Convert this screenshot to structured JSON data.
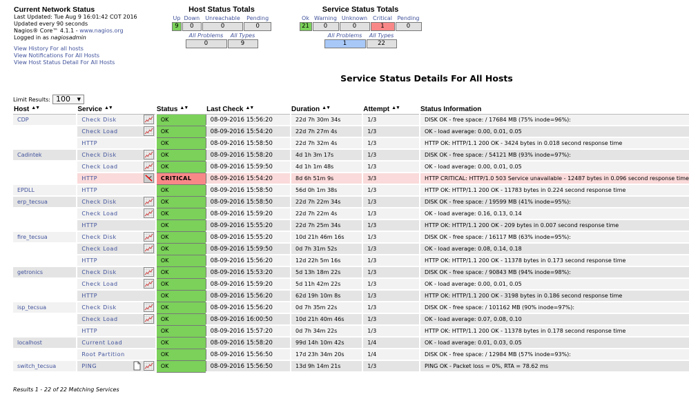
{
  "info": {
    "title": "Current Network Status",
    "last_updated": "Last Updated: Tue Aug 9 16:01:42 COT 2016",
    "update_interval": "Updated every 90 seconds",
    "version_prefix": "Nagios® Core™ 4.1.1 - ",
    "version_link": "www.nagios.org",
    "logged_in_prefix": "Logged in as ",
    "logged_in_user": "nagiosadmin",
    "links": [
      "View History For all hosts",
      "View Notifications For All Hosts",
      "View Host Status Detail For All Hosts"
    ]
  },
  "host_totals": {
    "title": "Host Status Totals",
    "labels": [
      "Up",
      "Down",
      "Unreachable",
      "Pending"
    ],
    "values": [
      "9",
      "0",
      "0",
      "0"
    ],
    "sub_labels": [
      "All Problems",
      "All Types"
    ],
    "sub_values": [
      "0",
      "9"
    ]
  },
  "service_totals": {
    "title": "Service Status Totals",
    "labels": [
      "Ok",
      "Warning",
      "Unknown",
      "Critical",
      "Pending"
    ],
    "values": [
      "21",
      "0",
      "0",
      "1",
      "0"
    ],
    "sub_labels": [
      "All Problems",
      "All Types"
    ],
    "sub_values": [
      "1",
      "22"
    ]
  },
  "page_title": "Service Status Details For All Hosts",
  "limit": {
    "label": "Limit Results:",
    "value": "100"
  },
  "columns": [
    "Host",
    "Service",
    "Status",
    "Last Check",
    "Duration",
    "Attempt",
    "Status Information"
  ],
  "colors": {
    "ok": "#7bd15a",
    "critical": "#f88888",
    "problems": "#a8c8f8",
    "link": "#40529b"
  },
  "rows": [
    {
      "host": "CDP",
      "service": "Check Disk",
      "graph": true,
      "status": "OK",
      "last_check": "08-09-2016 15:56:20",
      "duration": "22d 7h 30m 34s",
      "attempt": "1/3",
      "info": "DISK OK - free space: / 17684 MB (75% inode=96%):"
    },
    {
      "host": "",
      "service": "Check Load",
      "graph": true,
      "status": "OK",
      "last_check": "08-09-2016 15:54:20",
      "duration": "22d 7h 27m 4s",
      "attempt": "1/3",
      "info": "OK - load average: 0.00, 0.01, 0.05"
    },
    {
      "host": "",
      "service": "HTTP",
      "graph": false,
      "status": "OK",
      "last_check": "08-09-2016 15:58:50",
      "duration": "22d 7h 32m 4s",
      "attempt": "1/3",
      "info": "HTTP OK: HTTP/1.1 200 OK - 3424 bytes in 0.018 second response time"
    },
    {
      "host": "Cadintek",
      "service": "Check Disk",
      "graph": true,
      "status": "OK",
      "last_check": "08-09-2016 15:58:20",
      "duration": "4d 1h 3m 17s",
      "attempt": "1/3",
      "info": "DISK OK - free space: / 54121 MB (93% inode=97%):"
    },
    {
      "host": "",
      "service": "Check Load",
      "graph": true,
      "status": "OK",
      "last_check": "08-09-2016 15:59:50",
      "duration": "4d 1h 1m 48s",
      "attempt": "1/3",
      "info": "OK - load average: 0.00, 0.01, 0.05"
    },
    {
      "host": "",
      "service": "HTTP",
      "graph": "disabled",
      "status": "CRITICAL",
      "last_check": "08-09-2016 15:54:20",
      "duration": "8d 6h 51m 9s",
      "attempt": "3/3",
      "info": "HTTP CRITICAL: HTTP/1.0 503 Service unavailable - 12487 bytes in 0.096 second response time"
    },
    {
      "host": "EPDLL",
      "service": "HTTP",
      "graph": false,
      "status": "OK",
      "last_check": "08-09-2016 15:58:50",
      "duration": "56d 0h 1m 38s",
      "attempt": "1/3",
      "info": "HTTP OK: HTTP/1.1 200 OK - 11783 bytes in 0.224 second response time"
    },
    {
      "host": "erp_tecsua",
      "service": "Check Disk",
      "graph": true,
      "status": "OK",
      "last_check": "08-09-2016 15:58:50",
      "duration": "22d 7h 22m 34s",
      "attempt": "1/3",
      "info": "DISK OK - free space: / 19599 MB (41% inode=95%):"
    },
    {
      "host": "",
      "service": "Check Load",
      "graph": true,
      "status": "OK",
      "last_check": "08-09-2016 15:59:20",
      "duration": "22d 7h 22m 4s",
      "attempt": "1/3",
      "info": "OK - load average: 0.16, 0.13, 0.14"
    },
    {
      "host": "",
      "service": "HTTP",
      "graph": false,
      "status": "OK",
      "last_check": "08-09-2016 15:55:20",
      "duration": "22d 7h 25m 34s",
      "attempt": "1/3",
      "info": "HTTP OK: HTTP/1.1 200 OK - 209 bytes in 0.007 second response time"
    },
    {
      "host": "fire_tecsua",
      "service": "Check Disk",
      "graph": true,
      "status": "OK",
      "last_check": "08-09-2016 15:55:20",
      "duration": "10d 21h 46m 16s",
      "attempt": "1/3",
      "info": "DISK OK - free space: / 16117 MB (63% inode=95%):"
    },
    {
      "host": "",
      "service": "Check Load",
      "graph": true,
      "status": "OK",
      "last_check": "08-09-2016 15:59:50",
      "duration": "0d 7h 31m 52s",
      "attempt": "1/3",
      "info": "OK - load average: 0.08, 0.14, 0.18"
    },
    {
      "host": "",
      "service": "HTTP",
      "graph": false,
      "status": "OK",
      "last_check": "08-09-2016 15:56:20",
      "duration": "12d 22h 5m 16s",
      "attempt": "1/3",
      "info": "HTTP OK: HTTP/1.1 200 OK - 11378 bytes in 0.173 second response time"
    },
    {
      "host": "getronics",
      "service": "Check Disk",
      "graph": true,
      "status": "OK",
      "last_check": "08-09-2016 15:53:20",
      "duration": "5d 13h 18m 22s",
      "attempt": "1/3",
      "info": "DISK OK - free space: / 90843 MB (94% inode=98%):"
    },
    {
      "host": "",
      "service": "Check Load",
      "graph": true,
      "status": "OK",
      "last_check": "08-09-2016 15:59:20",
      "duration": "5d 11h 42m 22s",
      "attempt": "1/3",
      "info": "OK - load average: 0.00, 0.01, 0.05"
    },
    {
      "host": "",
      "service": "HTTP",
      "graph": false,
      "status": "OK",
      "last_check": "08-09-2016 15:56:20",
      "duration": "62d 19h 10m 8s",
      "attempt": "1/3",
      "info": "HTTP OK: HTTP/1.1 200 OK - 3198 bytes in 0.186 second response time"
    },
    {
      "host": "isp_tecsua",
      "service": "Check Disk",
      "graph": true,
      "status": "OK",
      "last_check": "08-09-2016 15:56:20",
      "duration": "0d 7h 35m 22s",
      "attempt": "1/3",
      "info": "DISK OK - free space: / 101162 MB (90% inode=97%):"
    },
    {
      "host": "",
      "service": "Check Load",
      "graph": true,
      "status": "OK",
      "last_check": "08-09-2016 16:00:50",
      "duration": "10d 21h 40m 46s",
      "attempt": "1/3",
      "info": "OK - load average: 0.07, 0.08, 0.10"
    },
    {
      "host": "",
      "service": "HTTP",
      "graph": false,
      "status": "OK",
      "last_check": "08-09-2016 15:57:20",
      "duration": "0d 7h 34m 22s",
      "attempt": "1/3",
      "info": "HTTP OK: HTTP/1.1 200 OK - 11378 bytes in 0.178 second response time"
    },
    {
      "host": "localhost",
      "service": "Current Load",
      "graph": false,
      "status": "OK",
      "last_check": "08-09-2016 15:58:20",
      "duration": "99d 14h 10m 42s",
      "attempt": "1/4",
      "info": "OK - load average: 0.01, 0.03, 0.05"
    },
    {
      "host": "",
      "service": "Root Partition",
      "graph": false,
      "status": "OK",
      "last_check": "08-09-2016 15:56:50",
      "duration": "17d 23h 34m 20s",
      "attempt": "1/4",
      "info": "DISK OK - free space: / 12984 MB (57% inode=93%):"
    },
    {
      "host": "switch_tecsua",
      "service": "PING",
      "graph": true,
      "notes": true,
      "status": "OK",
      "last_check": "08-09-2016 15:56:50",
      "duration": "13d 9h 14m 21s",
      "attempt": "1/3",
      "info": "PING OK - Packet loss = 0%, RTA = 78.62 ms"
    }
  ],
  "footer": "Results 1 - 22 of 22 Matching Services"
}
